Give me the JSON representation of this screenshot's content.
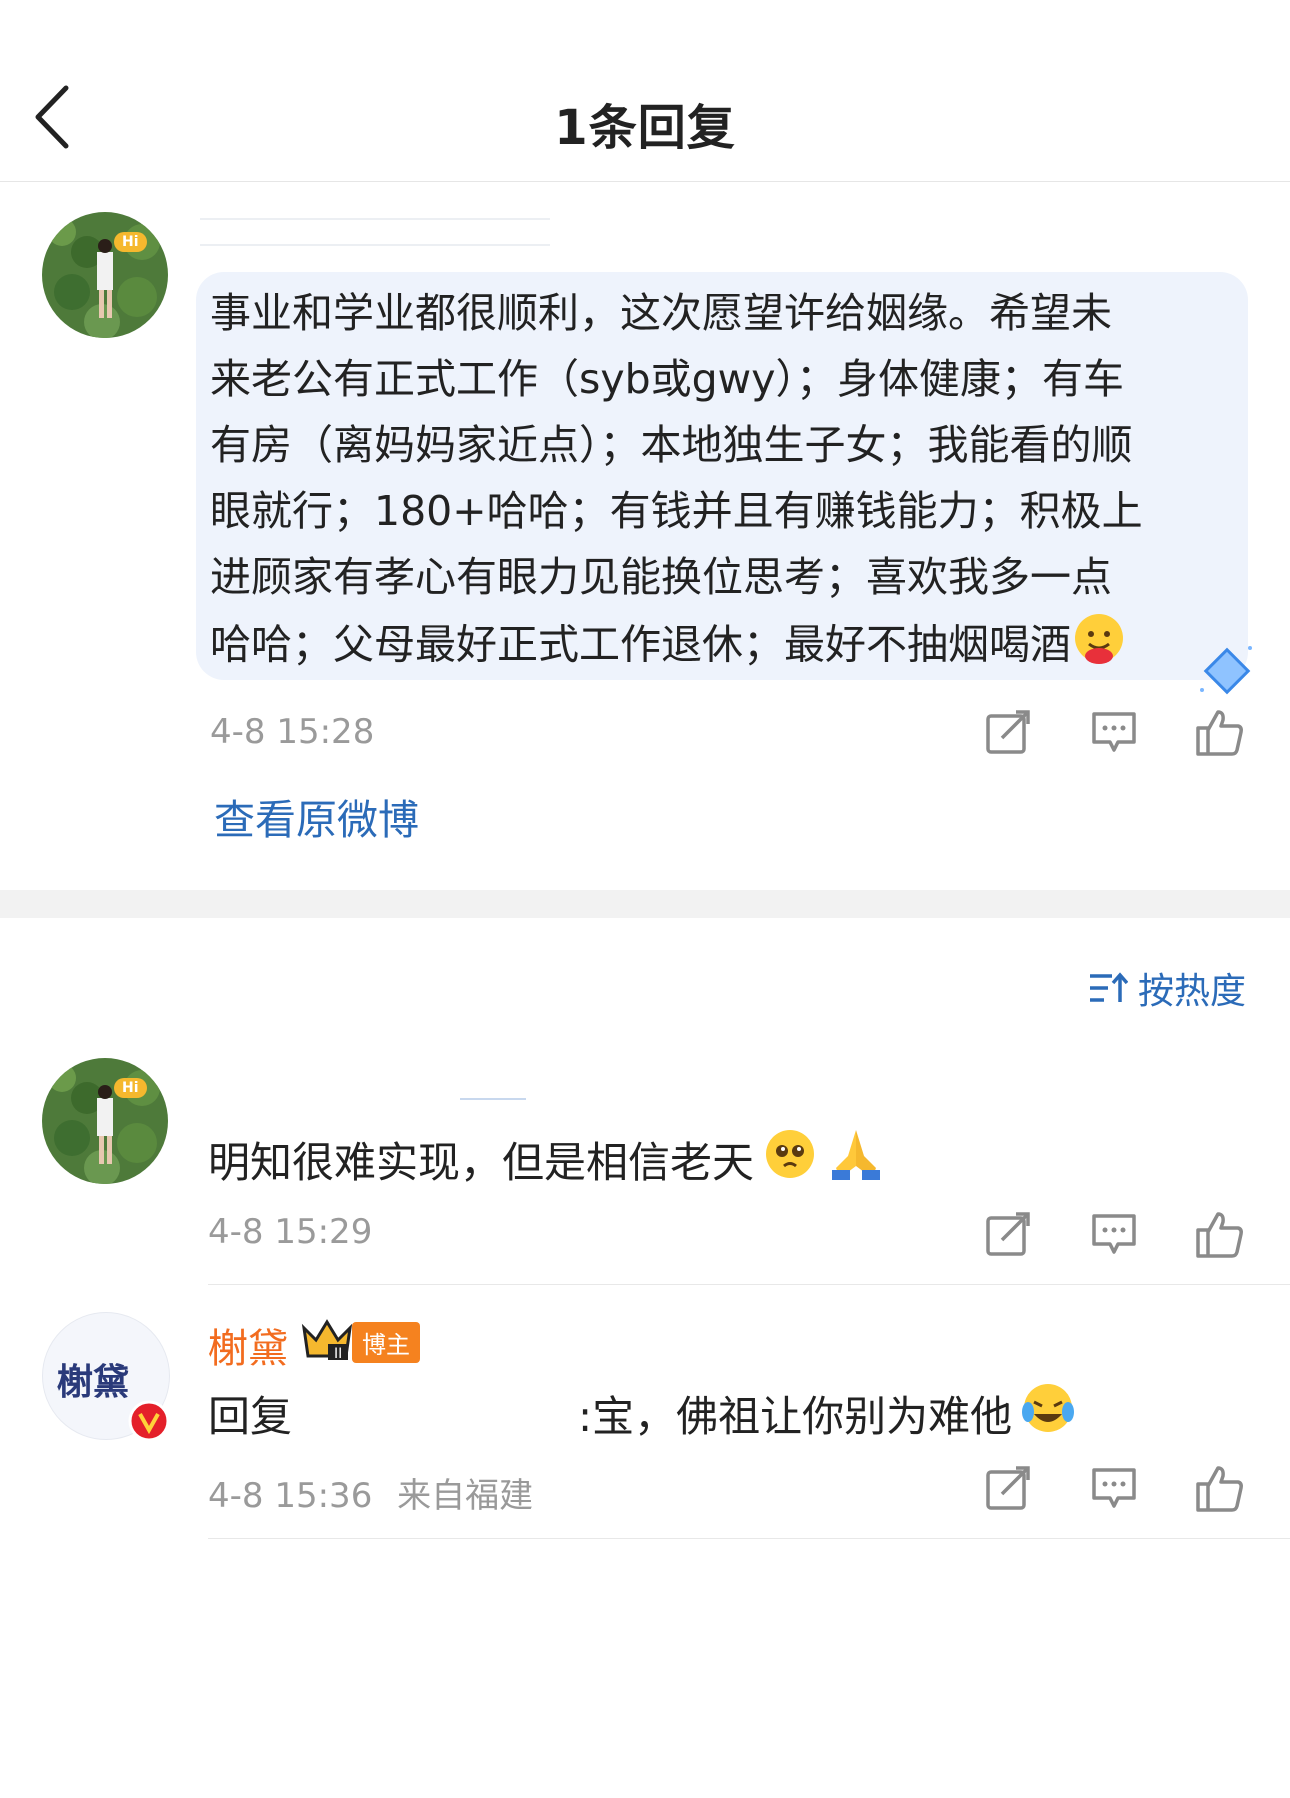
{
  "header": {
    "title": "1条回复",
    "back_icon": "chevron-left-icon"
  },
  "post": {
    "avatar_badge": "Hi",
    "text_lines": [
      "事业和学业都很顺利，这次愿望许给姻缘。希望未",
      "来老公有正式工作（syb或gwy）；身体健康；有车",
      "有房（离妈妈家近点）；本地独生子女；我能看的顺",
      "眼就行；180+哈哈；有钱并且有赚钱能力；积极上",
      "进顾家有孝心有眼力见能换位思考；喜欢我多一点",
      "哈哈；父母最好正式工作退休；最好不抽烟喝酒"
    ],
    "time": "4-8 15:28",
    "view_original": "查看原微博"
  },
  "sort": {
    "label": "按热度",
    "icon": "sort-icon"
  },
  "comments": [
    {
      "avatar_badge": "Hi",
      "text": "明知很难实现，但是相信老天",
      "time": "4-8 15:29"
    },
    {
      "name": "榭黛",
      "avatar_text": "榭黛",
      "badge": "博主",
      "reply_prefix": "回复",
      "reply_text": ":宝，佛祖让你别为难他",
      "time": "4-8 15:36",
      "location": "来自福建"
    }
  ],
  "colors": {
    "accent_blue": "#2b6bb8",
    "blogger_orange": "#f26c1f",
    "bubble_bg": "#eef3fc"
  }
}
